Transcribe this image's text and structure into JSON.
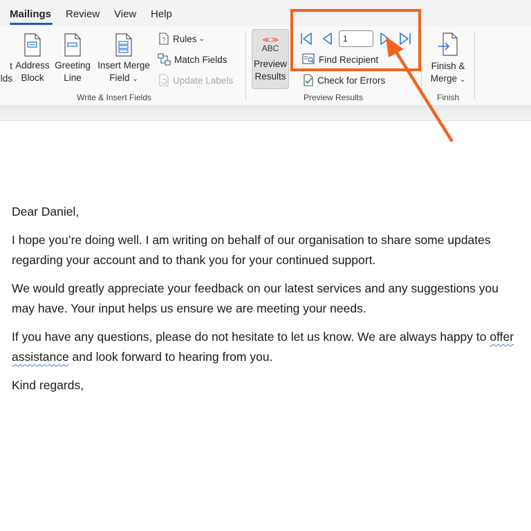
{
  "tabs": [
    {
      "label": "Mailings",
      "active": true
    },
    {
      "label": "Review",
      "active": false
    },
    {
      "label": "View",
      "active": false
    },
    {
      "label": "Help",
      "active": false
    }
  ],
  "ribbon": {
    "write_insert": {
      "clipped_label_line1": "t",
      "clipped_label_line2": "lds",
      "address_block": {
        "line1": "Address",
        "line2": "Block"
      },
      "greeting_line": {
        "line1": "Greeting",
        "line2": "Line"
      },
      "insert_merge_field": {
        "line1": "Insert Merge",
        "line2": "Field"
      },
      "rules": "Rules",
      "match_fields": "Match Fields",
      "update_labels": "Update Labels",
      "group_label": "Write & Insert Fields"
    },
    "preview_results": {
      "toggle": {
        "icon_text": "ABC",
        "line1": "Preview",
        "line2": "Results",
        "pressed": true
      },
      "record_number": "1",
      "find_recipient": "Find Recipient",
      "check_for_errors": "Check for Errors",
      "group_label": "Preview Results"
    },
    "finish": {
      "finish_merge": {
        "line1": "Finish &",
        "line2": "Merge"
      },
      "group_label": "Finish"
    }
  },
  "document": {
    "salutation": "Dear Daniel,",
    "paragraph1": "I hope you’re doing well. I am writing on behalf of our organisation to share some updates regarding your account and to thank you for your continued support.",
    "paragraph2": "We would greatly appreciate your feedback on our latest services and any suggestions you may have. Your input helps us ensure we are meeting your needs.",
    "paragraph3_before": "If you have any questions, please do not hesitate to let us know. We are always happy to ",
    "paragraph3_flagged": "offer assistance",
    "paragraph3_after": " and look forward to hearing from you.",
    "closing": "Kind regards,"
  },
  "colors": {
    "accent": "#185abd",
    "highlight": "#f2641e",
    "nav_icon": "#2f7ad8",
    "preview_arrows": "#e04a3f"
  }
}
